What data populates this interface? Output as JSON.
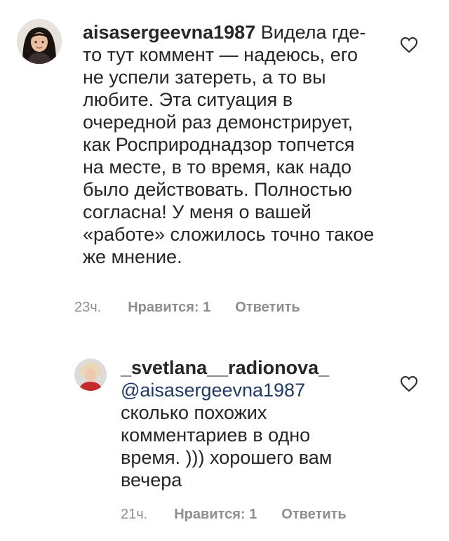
{
  "comments": [
    {
      "username": "aisasergeevna1987",
      "text": "Видела где-то тут коммент — надеюсь, его не успели затереть, а то вы любите. Эта ситуация в очередной раз демонстрирует, как Росприроднадзор топчется на месте, в то время, как надо было действовать. Полностью согласна! У меня о вашей «работе» сложилось точно такое же мнение.",
      "time": "23ч.",
      "likes": "Нравится: 1",
      "reply": "Ответить",
      "avatar_icon": "user-avatar-dark-hair"
    },
    {
      "username": "_svetlana__radionova_",
      "mention": "@aisasergeevna1987",
      "text": "сколько похожих комментариев в одно время. ))) хорошего вам вечера",
      "time": "21ч.",
      "likes": "Нравится: 1",
      "reply": "Ответить",
      "avatar_icon": "user-avatar-blonde-red"
    }
  ],
  "colors": {
    "text": "#262626",
    "meta": "#8e8e8e",
    "mention": "#1f3a66"
  },
  "icons": {
    "like": "heart-outline-icon"
  }
}
